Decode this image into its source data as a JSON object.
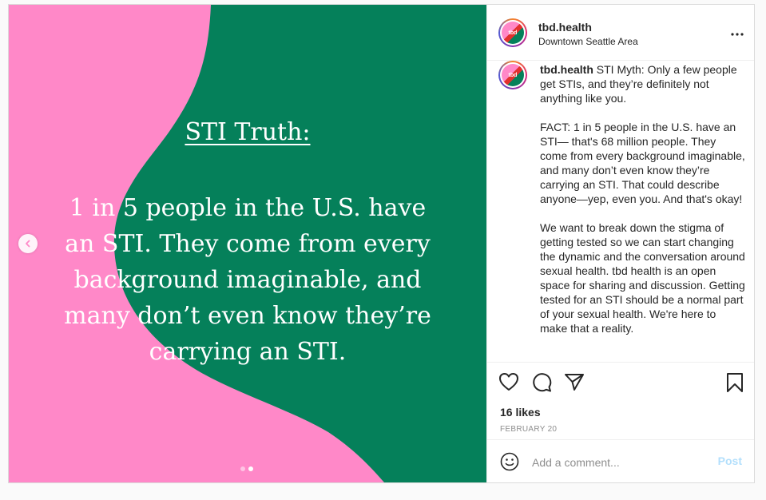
{
  "slide": {
    "title": "STI Truth:",
    "body": "1 in 5 people in the U.S. have an STI. They come from every background imaginable, and many don’t even know they’re carrying an STI.",
    "colors": {
      "pink": "#ff88c8",
      "green": "#05805a"
    },
    "slide_count": 2,
    "active_slide": 2
  },
  "header": {
    "username": "tbd.health",
    "location": "Downtown Seattle Area",
    "avatar_text": "tbd"
  },
  "caption": {
    "username": "tbd.health",
    "text": " STI Myth: Only a few people get STIs, and they’re definitely not anything like you.\n\nFACT: 1 in 5 people in the U.S. have an STI— that's 68 million people. They come from every background imaginable, and many don’t even know they’re carrying an STI. That could describe anyone—yep, even you. And that's okay!\n\nWe want to break down the stigma of getting tested so we can start changing the dynamic and the conversation around sexual health. tbd health is an open space for sharing and discussion. Getting tested for an STI should be a normal part of your sexual health. We're here to make that a reality."
  },
  "engagement": {
    "likes": "16 likes",
    "date": "FEBRUARY 20"
  },
  "comment_box": {
    "placeholder": "Add a comment...",
    "post_label": "Post"
  },
  "icons": {
    "like": "heart-icon",
    "comment": "comment-bubble-icon",
    "share": "paper-plane-icon",
    "save": "bookmark-icon",
    "emoji": "emoji-icon",
    "more": "more-options-icon",
    "prev": "chevron-left-icon"
  }
}
